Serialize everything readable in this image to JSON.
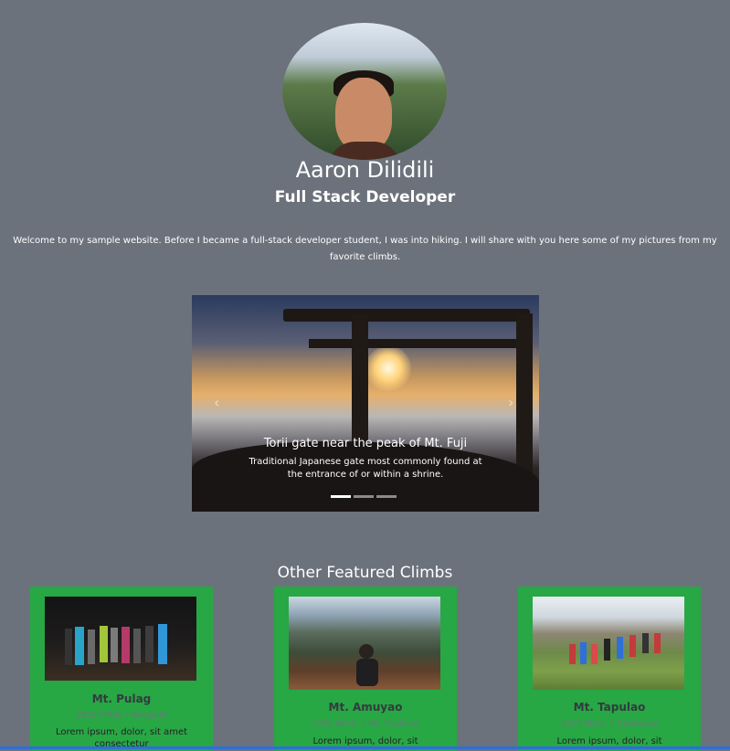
{
  "profile": {
    "name": "Aaron Dilidili",
    "role": "Full Stack Developer",
    "intro": "Welcome to my sample website. Before I became a full-stack developer student, I was into hiking. I will share with you here some of my pictures from my favorite climbs."
  },
  "carousel": {
    "prev_icon": "‹",
    "next_icon": "›",
    "slides": [
      {
        "title": "Torii gate near the peak of Mt. Fuji",
        "text": "Traditional Japanese gate most commonly found at the entrance of or within a shrine."
      }
    ],
    "active_index": 0,
    "indicator_count": 3
  },
  "featured": {
    "title": "Other Featured Climbs",
    "cards": [
      {
        "name": "Mt. Pulag",
        "subtitle": "2922 MASL • Benguet",
        "body": "Lorem ipsum, dolor, sit amet consectetur"
      },
      {
        "name": "Mt. Amuyao",
        "subtitle": "2702 MASL • Mt. Province",
        "body": "Lorem ipsum, dolor, sit"
      },
      {
        "name": "Mt. Tapulao",
        "subtitle": "2037 MASL • Zambales",
        "body": "Lorem ipsum, dolor, sit"
      }
    ]
  },
  "colors": {
    "page_bg": "#6c727c",
    "card_bg": "#28a745",
    "bottom_bar": "#2d6fd8"
  }
}
